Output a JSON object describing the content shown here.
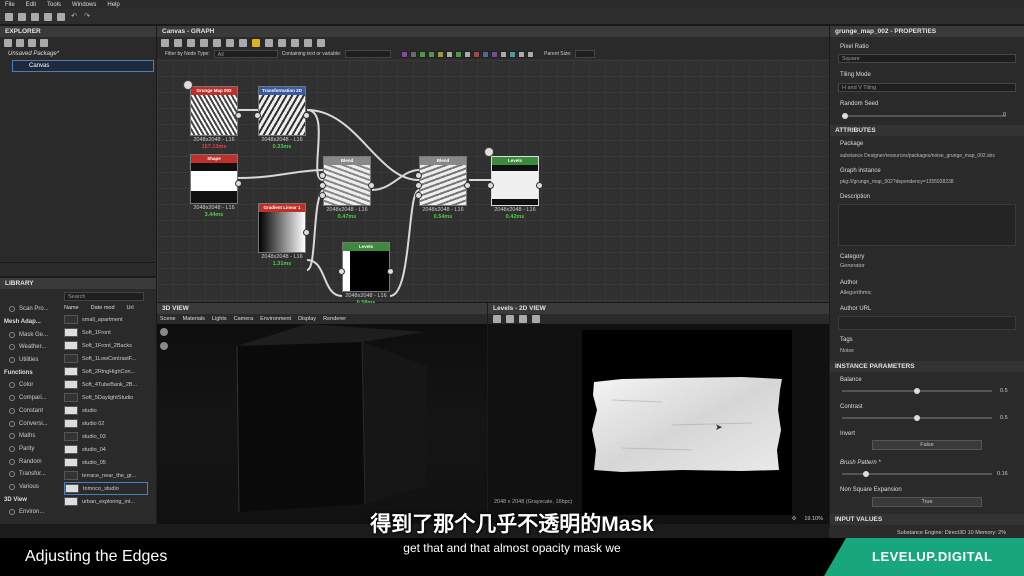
{
  "menu": [
    "File",
    "Edit",
    "Tools",
    "Windows",
    "Help"
  ],
  "explorer": {
    "title": "EXPLORER",
    "package": "Unsaved Package*",
    "item": "Canvas"
  },
  "library": {
    "title": "LIBRARY",
    "search_placeholder": "Search",
    "cols": [
      "Name",
      "Date mod",
      "Url"
    ],
    "tree": [
      {
        "label": "Scan Pro...",
        "hdr": false
      },
      {
        "label": "Mesh Adap...",
        "hdr": true
      },
      {
        "label": "Mask Ge...",
        "hdr": false
      },
      {
        "label": "Weather...",
        "hdr": false
      },
      {
        "label": "Utilities",
        "hdr": false
      },
      {
        "label": "Functions",
        "hdr": true
      },
      {
        "label": "Color",
        "hdr": false
      },
      {
        "label": "Compari...",
        "hdr": false
      },
      {
        "label": "Constant",
        "hdr": false
      },
      {
        "label": "Conversi...",
        "hdr": false
      },
      {
        "label": "Maths",
        "hdr": false
      },
      {
        "label": "Parity",
        "hdr": false
      },
      {
        "label": "Random",
        "hdr": false
      },
      {
        "label": "Transfor...",
        "hdr": false
      },
      {
        "label": "Various",
        "hdr": false
      },
      {
        "label": "3D View",
        "hdr": true
      },
      {
        "label": "Environ...",
        "hdr": false
      }
    ],
    "assets": [
      "small_apartment",
      "Soft_1Front",
      "Soft_1Front_2Backs",
      "Soft_1LowContrastF...",
      "Soft_2RingHighCon...",
      "Soft_4TubeBank_2B...",
      "Soft_5DaylightStudio",
      "studio",
      "studio 02",
      "studio_03",
      "studio_04",
      "studio_05",
      "terrace_near_the_gr...",
      "tomoco_studio",
      "urban_exploring_int..."
    ]
  },
  "graph": {
    "title": "Canvas - GRAPH",
    "filter_label": "Filter by Node Type:",
    "filter_value": "All",
    "contain_label": "Containing text or variable:",
    "parent_size": "Parent Size:",
    "nodes": [
      {
        "title": "Grunge Map 002",
        "color": "#c0302a",
        "res": "2048x2048 - L16",
        "time": "157.13ms",
        "tcolor": "#e04040"
      },
      {
        "title": "Transformation 2D",
        "color": "#3a5aa0",
        "res": "2048x2048 - L16",
        "time": "0.33ms",
        "tcolor": "#4cd04c"
      },
      {
        "title": "Shape",
        "color": "#c0302a",
        "res": "2048x2048 - L16",
        "time": "3.44ms",
        "tcolor": "#4cd04c"
      },
      {
        "title": "Blend",
        "color": "#888",
        "res": "2048x2048 - L16",
        "time": "0.47ms",
        "tcolor": "#4cd04c"
      },
      {
        "title": "Blend",
        "color": "#888",
        "res": "2048x2048 - L16",
        "time": "0.54ms",
        "tcolor": "#4cd04c"
      },
      {
        "title": "Levels",
        "color": "#3c8a3c",
        "res": "2048x2048 - L16",
        "time": "0.42ms",
        "tcolor": "#4cd04c"
      },
      {
        "title": "Gradient Linear 1",
        "color": "#c0302a",
        "res": "2048x2048 - L16",
        "time": "1.31ms",
        "tcolor": "#4cd04c"
      },
      {
        "title": "Levels",
        "color": "#3c8a3c",
        "res": "2048x2048 - L16",
        "time": "0.58ms",
        "tcolor": "#4cd04c"
      }
    ]
  },
  "view3d": {
    "title": "3D VIEW",
    "menu": [
      "Scene",
      "Materials",
      "Lights",
      "Camera",
      "Environment",
      "Display",
      "Renderer"
    ]
  },
  "view2d": {
    "title": "Levels - 2D VIEW",
    "info": "2048 x 2048 (Grayscale, 16bpc)",
    "zoom": "19.10%"
  },
  "props": {
    "title": "grunge_map_002 - PROPERTIES",
    "pixel_ratio": "Pixel Ratio",
    "pixel_ratio_val": "Square",
    "tiling": "Tiling Mode",
    "tiling_val": "H and V Tiling",
    "seed": "Random Seed",
    "seed_val": "0",
    "attributes": "ATTRIBUTES",
    "package": "Package",
    "package_val": "substance Designer/resources/packages/noise_grunge_map_002.sbs",
    "instance": "Graph instance",
    "instance_val": "pkg:///grunge_map_002?dependency=1355938238",
    "description": "Description",
    "category": "Category",
    "category_val": "Generator",
    "author": "Author",
    "author_val": "Allegorithmic",
    "author_url": "Author URL",
    "tags": "Tags",
    "tags_val": "Noise",
    "instance_params": "INSTANCE PARAMETERS",
    "balance": "Balance",
    "balance_val": "0.5",
    "balance_frac": 0.5,
    "contrast": "Contrast",
    "contrast_val": "0.5",
    "contrast_frac": 0.5,
    "invert": "Invert",
    "invert_val": "False",
    "brush": "Brush Pattern *",
    "brush_val": "0.16",
    "brush_frac": 0.16,
    "nonsquare": "Non Square Expansion",
    "nonsquare_val": "True",
    "input_values": "INPUT VALUES"
  },
  "status": "Substance Engine: Direct3D 10   Memory: 2%",
  "caption": {
    "title": "Adjusting the Edges",
    "brand": "LEVELUP.DIGITAL"
  },
  "subtitles": {
    "zh": "得到了那个几乎不透明的Mask",
    "en": "get that and that almost opacity mask we"
  }
}
